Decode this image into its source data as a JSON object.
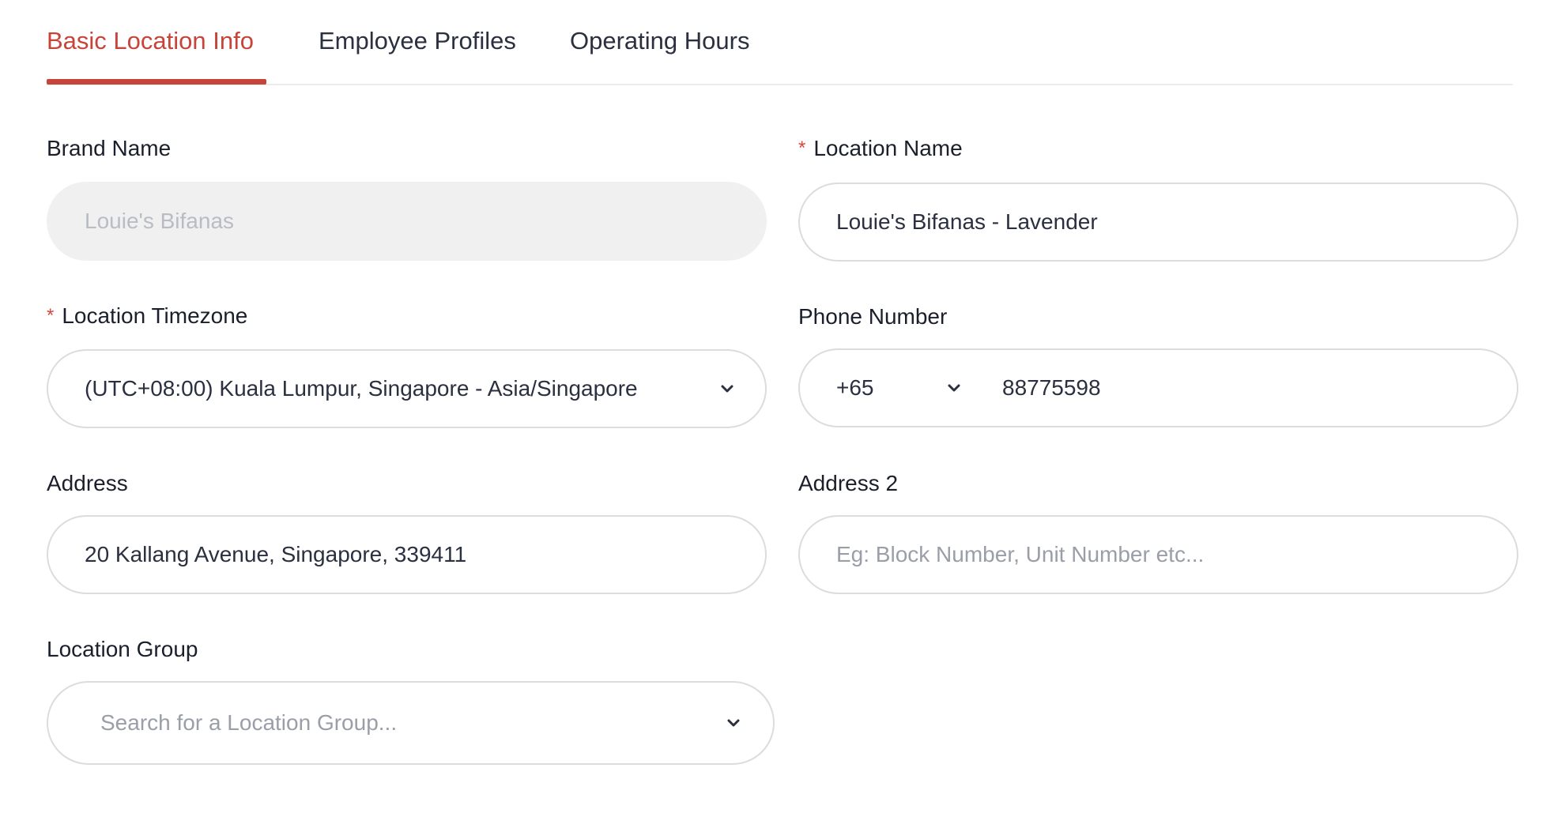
{
  "tabs": [
    {
      "label": "Basic Location Info",
      "active": true
    },
    {
      "label": "Employee Profiles",
      "active": false
    },
    {
      "label": "Operating Hours",
      "active": false
    }
  ],
  "form": {
    "brand_name": {
      "label": "Brand Name",
      "value": "Louie's Bifanas"
    },
    "location_name": {
      "required_mark": "*",
      "label": "Location Name",
      "value": "Louie's Bifanas - Lavender"
    },
    "location_timezone": {
      "required_mark": "*",
      "label": "Location Timezone",
      "value": "(UTC+08:00) Kuala Lumpur, Singapore - Asia/Singapore"
    },
    "phone_number": {
      "label": "Phone Number",
      "country_code": "+65",
      "value": "88775598"
    },
    "address": {
      "label": "Address",
      "value": "20 Kallang Avenue, Singapore, 339411"
    },
    "address_2": {
      "label": "Address 2",
      "placeholder": "Eg: Block Number, Unit Number etc..."
    },
    "location_group": {
      "label": "Location Group",
      "placeholder": "Search for a Location Group..."
    }
  },
  "icons": {
    "dropdown": "chevron-down-icon"
  },
  "colors": {
    "accent": "#c7443a",
    "required": "#d9473c",
    "border": "#dcdcdc",
    "disabled_bg": "#f0f0f0"
  }
}
